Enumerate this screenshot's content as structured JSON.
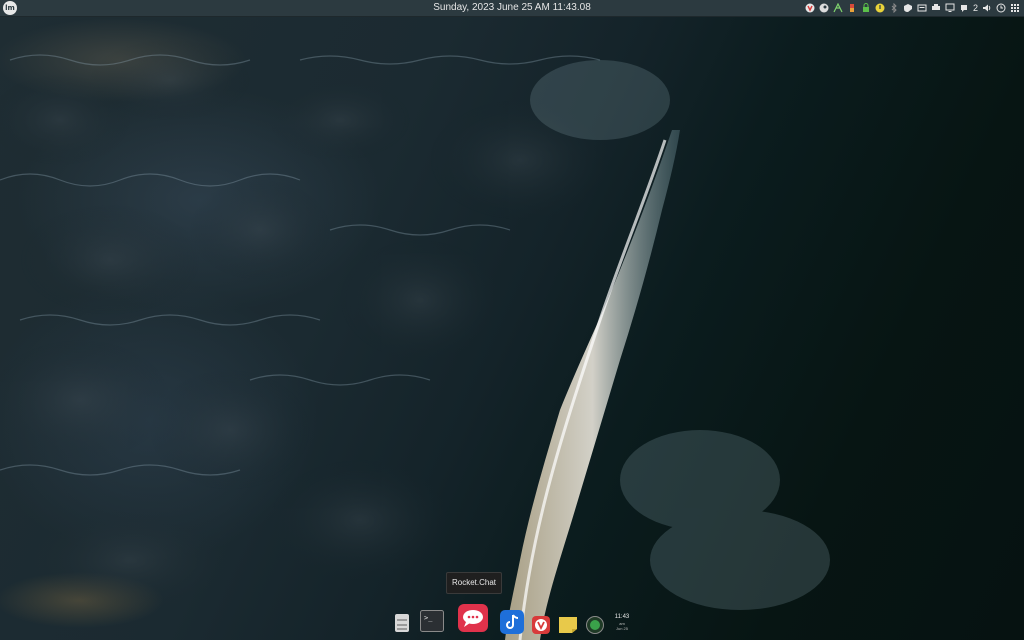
{
  "top_panel": {
    "datetime": "Sunday, 2023 June 25 AM 11:43.08",
    "menu_logo": "lm",
    "tray": {
      "notification_count": "2",
      "icons": [
        "vivaldi-tray-icon",
        "steam-icon",
        "network-tool-icon",
        "battery-status-icon",
        "lock-icon",
        "update-icon",
        "bluetooth-icon",
        "vpn-icon",
        "keyboard-icon",
        "printer-icon",
        "display-icon",
        "notification-icon",
        "volume-icon",
        "clock-tray-icon",
        "grid-menu-icon"
      ]
    }
  },
  "tooltip": {
    "text": "Rocket.Chat"
  },
  "dock": {
    "items": [
      {
        "name": "files",
        "icon": "files-icon"
      },
      {
        "name": "terminal",
        "icon": "terminal-icon",
        "glyph": ">_"
      },
      {
        "name": "rocket-chat",
        "icon": "rocket-chat-icon"
      },
      {
        "name": "tiktok",
        "icon": "tiktok-icon"
      },
      {
        "name": "vivaldi",
        "icon": "vivaldi-icon"
      },
      {
        "name": "notes",
        "icon": "sticky-notes-icon"
      },
      {
        "name": "app",
        "icon": "green-circle-icon"
      }
    ],
    "clock_widget": {
      "time": "11:43",
      "ampm": "am",
      "date": "Jun 25"
    }
  },
  "colors": {
    "panel": "#2c3a40",
    "rocket_chat": "#e0324b",
    "tiktok": "#1e6fd9",
    "vivaldi": "#d83a3a",
    "notes": "#e8c94a",
    "green_circle": "#3aa24a"
  }
}
